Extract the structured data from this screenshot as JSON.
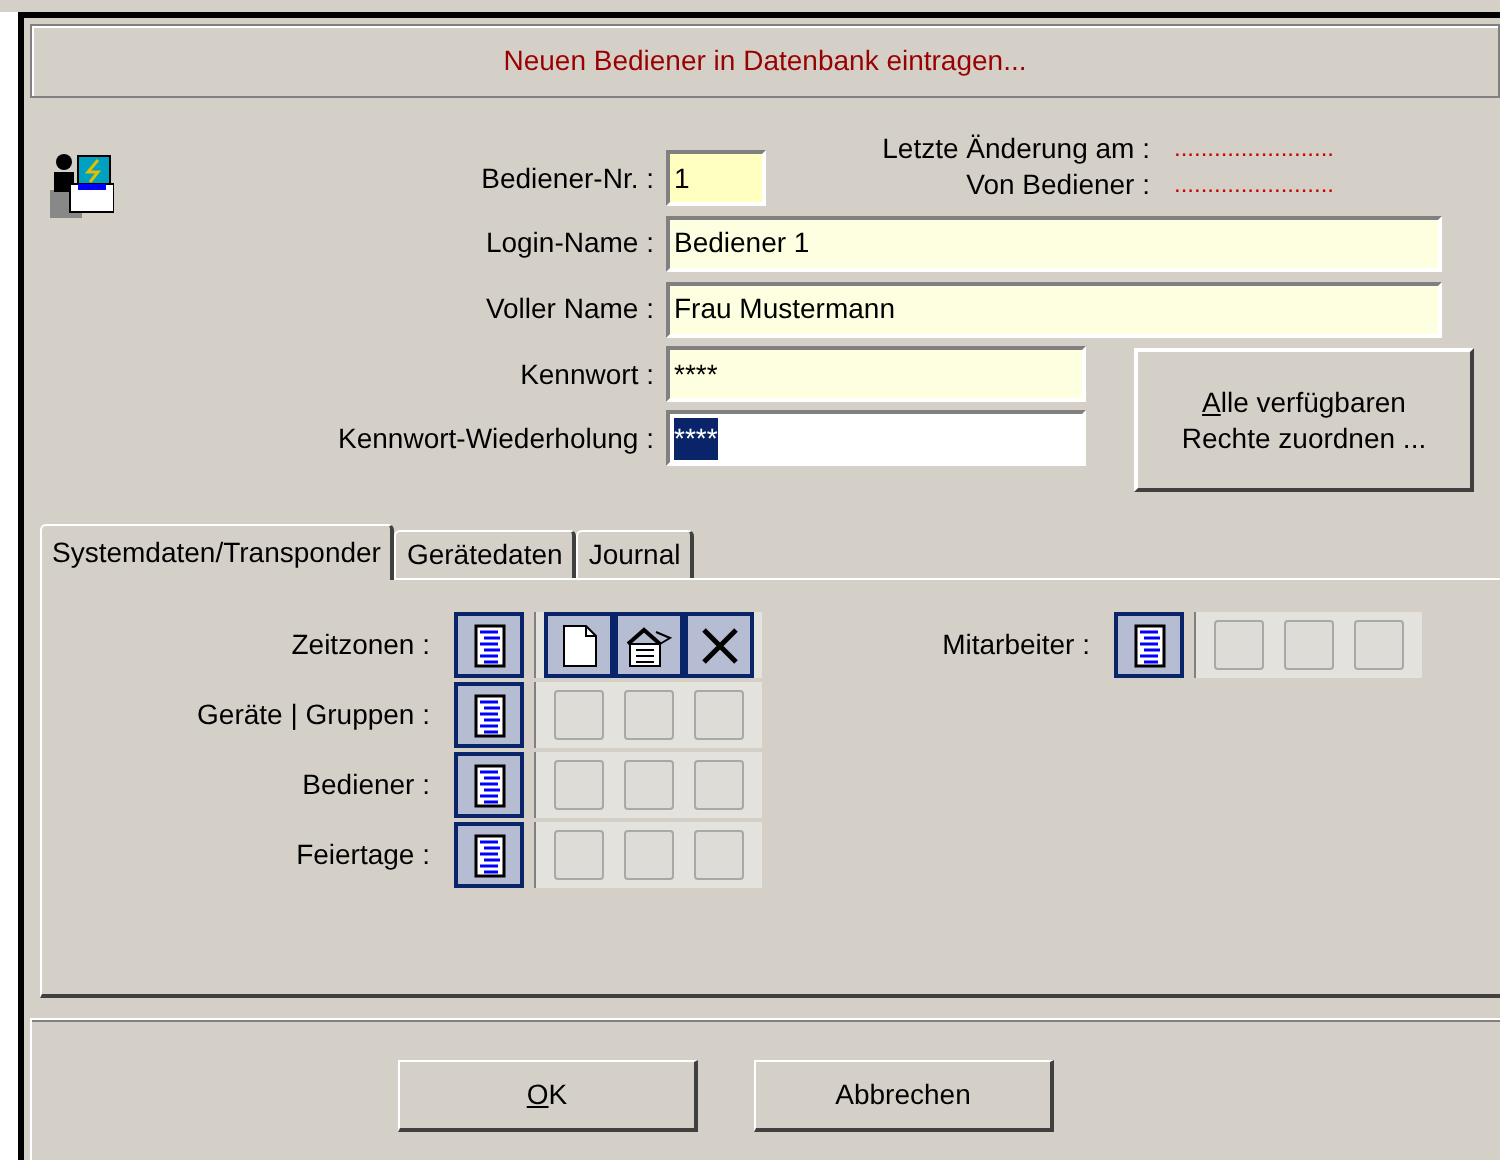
{
  "header": {
    "title": "Neuen Bediener in Datenbank eintragen..."
  },
  "fields": [
    {
      "label": "Bediener-Nr. :",
      "value": "1",
      "kind": "short"
    },
    {
      "label": "Login-Name :",
      "value": "Bediener 1",
      "kind": "wide"
    },
    {
      "label": "Voller Name :",
      "value": "Frau Mustermann",
      "kind": "wide"
    },
    {
      "label": "Kennwort :",
      "value": "****",
      "kind": "medium",
      "selected": false
    },
    {
      "label": "Kennwort-Wiederholung :",
      "value": "****",
      "kind": "medium",
      "selected": true
    }
  ],
  "info": [
    {
      "label": "Letzte Änderung am :",
      "value": "........................"
    },
    {
      "label": "Von Bediener :",
      "value": "........................"
    }
  ],
  "assign_button": {
    "accel": "A",
    "rest": "lle verfügbaren",
    "line2": "Rechte zuordnen ..."
  },
  "tabs": [
    {
      "label": "Systemdaten/Transponder",
      "selected": true
    },
    {
      "label": "Gerätedaten",
      "selected": false
    },
    {
      "label": "Journal",
      "selected": false
    }
  ],
  "permissions": [
    {
      "label": "Zeitzonen :",
      "view_on": true,
      "actions": [
        {
          "kind": "new",
          "enabled": true
        },
        {
          "kind": "edit",
          "enabled": true
        },
        {
          "kind": "delete",
          "enabled": true
        }
      ]
    },
    {
      "label": "Geräte | Gruppen :",
      "view_on": true,
      "actions": [
        {
          "enabled": false
        },
        {
          "enabled": false
        },
        {
          "enabled": false
        }
      ]
    },
    {
      "label": "Bediener :",
      "view_on": true,
      "actions": [
        {
          "enabled": false
        },
        {
          "enabled": false
        },
        {
          "enabled": false
        }
      ]
    },
    {
      "label": "Feiertage :",
      "view_on": true,
      "actions": [
        {
          "enabled": false
        },
        {
          "enabled": false
        },
        {
          "enabled": false
        }
      ]
    }
  ],
  "permissions_right": [
    {
      "label": "Mitarbeiter :",
      "view_on": true,
      "actions": [
        {
          "enabled": false
        },
        {
          "enabled": false
        },
        {
          "enabled": false
        }
      ]
    }
  ],
  "buttons": [
    {
      "accel": "O",
      "rest": "K"
    },
    {
      "rest": "Abbrechen"
    }
  ]
}
